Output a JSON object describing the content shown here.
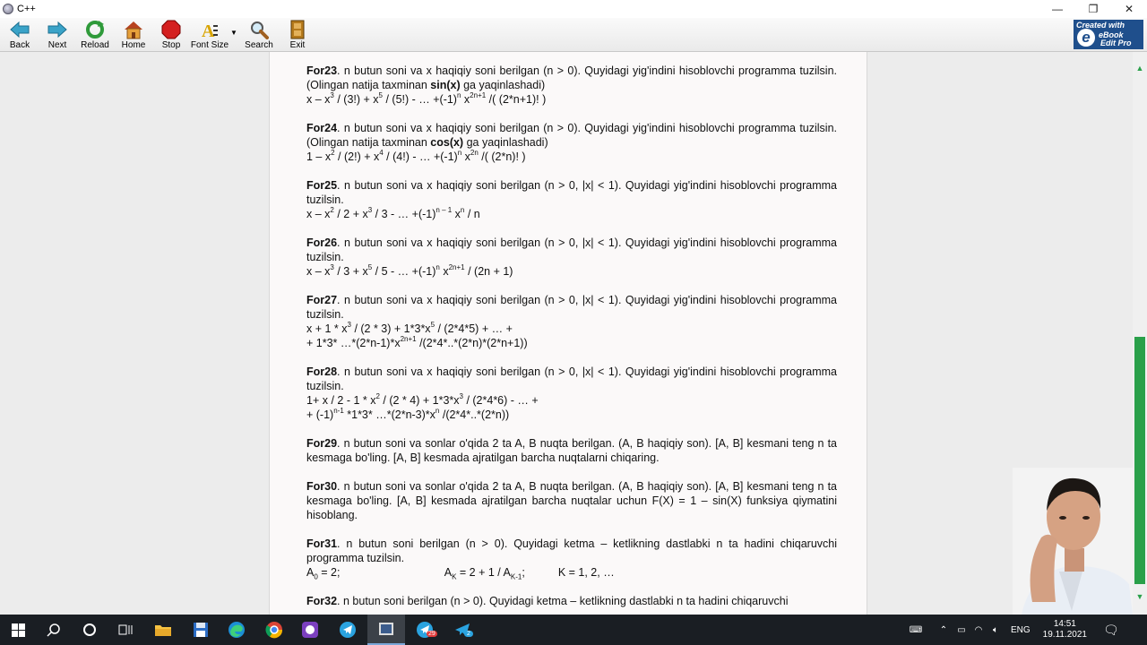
{
  "window": {
    "title": "C++",
    "controls": [
      "—",
      "❐",
      "✕"
    ]
  },
  "toolbar": {
    "buttons": [
      {
        "label": "Back"
      },
      {
        "label": "Next"
      },
      {
        "label": "Reload"
      },
      {
        "label": "Home"
      },
      {
        "label": "Stop"
      },
      {
        "label": "Font Size"
      },
      {
        "label": "Search"
      },
      {
        "label": "Exit"
      }
    ],
    "brand": {
      "line1": "Created with",
      "mark": "e",
      "line2": "eBook",
      "line3": "Edit Pro"
    }
  },
  "tasks": [
    {
      "id": "For23",
      "text": ". n butun soni va x haqiqiy soni berilgan (n > 0). Quyidagi yig'indini hisoblovchi programma tuzilsin. (Olingan natija taxminan ",
      "bold": "sin(x)",
      "tail": " ga yaqinlashadi)"
    },
    {
      "id": "For24",
      "text": ". n butun soni va x haqiqiy soni berilgan (n > 0). Quyidagi yig'indini hisoblovchi programma tuzilsin. (Olingan natija taxminan ",
      "bold": "cos(x)",
      "tail": " ga yaqinlashadi)"
    },
    {
      "id": "For25",
      "text": ". n butun soni va x haqiqiy soni berilgan (n > 0, |x| < 1). Quyidagi yig'indini hisoblovchi programma tuzilsin."
    },
    {
      "id": "For26",
      "text": ". n butun soni va x haqiqiy soni berilgan (n > 0, |x| < 1). Quyidagi yig'indini hisoblovchi programma tuzilsin."
    },
    {
      "id": "For27",
      "text": ". n butun soni va x haqiqiy soni berilgan (n > 0, |x| < 1). Quyidagi yig'indini hisoblovchi programma tuzilsin."
    },
    {
      "id": "For28",
      "text": ". n butun soni va x haqiqiy soni berilgan (n > 0, |x| < 1). Quyidagi yig'indini hisoblovchi programma tuzilsin."
    },
    {
      "id": "For29",
      "text": ". n butun soni va sonlar o'qida 2 ta A, B nuqta berilgan. (A, B haqiqiy son). [A, B] kesmani teng n ta kesmaga bo'ling. [A, B] kesmada ajratilgan barcha nuqtalarni chiqaring."
    },
    {
      "id": "For30",
      "text": ". n butun soni va sonlar o'qida 2 ta A, B nuqta berilgan. (A, B haqiqiy son). [A, B] kesmani teng n ta kesmaga bo'ling. [A, B] kesmada ajratilgan barcha nuqtalar uchun F(X) = 1 – sin(X) funksiya qiymatini hisoblang."
    },
    {
      "id": "For31",
      "text": ". n butun soni berilgan (n > 0). Quyidagi ketma – ketlikning dastlabki n ta hadini chiqaruvchi programma tuzilsin."
    },
    {
      "id": "For32",
      "text": ". n butun soni berilgan (n > 0). Quyidagi ketma – ketlikning dastlabki n ta hadini chiqaruvchi"
    }
  ],
  "formulas": {
    "f23": {
      "p1": "x – x",
      "s1": "3",
      "p2": " / (3!) + x",
      "s2": "5",
      "p3": " / (5!) - … +(-1)",
      "s3": "n",
      "p4": " x",
      "s4": "2n+1",
      "p5": " /( (2*n+1)! )"
    },
    "f24": {
      "p1": "1 – x",
      "s1": "2",
      "p2": " / (2!) + x",
      "s2": "4",
      "p3": " / (4!) - … +(-1)",
      "s3": "n",
      "p4": " x",
      "s4": "2n",
      "p5": " /( (2*n)! )"
    },
    "f25": {
      "p1": "x – x",
      "s1": "2",
      "p2": " / 2 + x",
      "s2": "3",
      "p3": " / 3 - … +(-1)",
      "s3": "n – 1",
      "p4": " x",
      "s4": "n",
      "p5": " / n"
    },
    "f26": {
      "p1": "x – x",
      "s1": "3",
      "p2": " / 3 + x",
      "s2": "5",
      "p3": " / 5 - … +(-1)",
      "s3": "n",
      "p4": " x",
      "s4": "2n+1",
      "p5": " / (2n + 1)"
    },
    "f27a": {
      "p1": "x + 1 * x",
      "s1": "3",
      "p2": " / (2 * 3) + 1*3*x",
      "s2": "5",
      "p3": " / (2*4*5) + … +"
    },
    "f27b": {
      "p1": "+ 1*3* …*(2*n-1)*x",
      "s1": "2n+1",
      "p2": " /(2*4*..*(2*n)*(2*n+1))"
    },
    "f28a": {
      "p1": "1+ x / 2 - 1 * x",
      "s1": "2",
      "p2": " / (2 * 4) + 1*3*x",
      "s2": "3",
      "p3": " / (2*4*6) - … +"
    },
    "f28b": {
      "p1": "+ (-1)",
      "s1": "n-1",
      "p2": " *1*3* …*(2*n-3)*x",
      "s2": "n",
      "p3": " /(2*4*..*(2*n))"
    },
    "f31": {
      "a0": "A",
      "a0sub": "0",
      "a0tail": " = 2;",
      "ak": "A",
      "aksub": "K",
      "akmid": " = 2 + 1 / A",
      "akm1": "K-1",
      "aktail": ";",
      "krange": "K = 1, 2, …"
    }
  },
  "taskbar": {
    "badges": [
      "29",
      "2"
    ],
    "tray": {
      "lang": "ENG",
      "time": "14:51",
      "date": "19.11.2021"
    }
  }
}
